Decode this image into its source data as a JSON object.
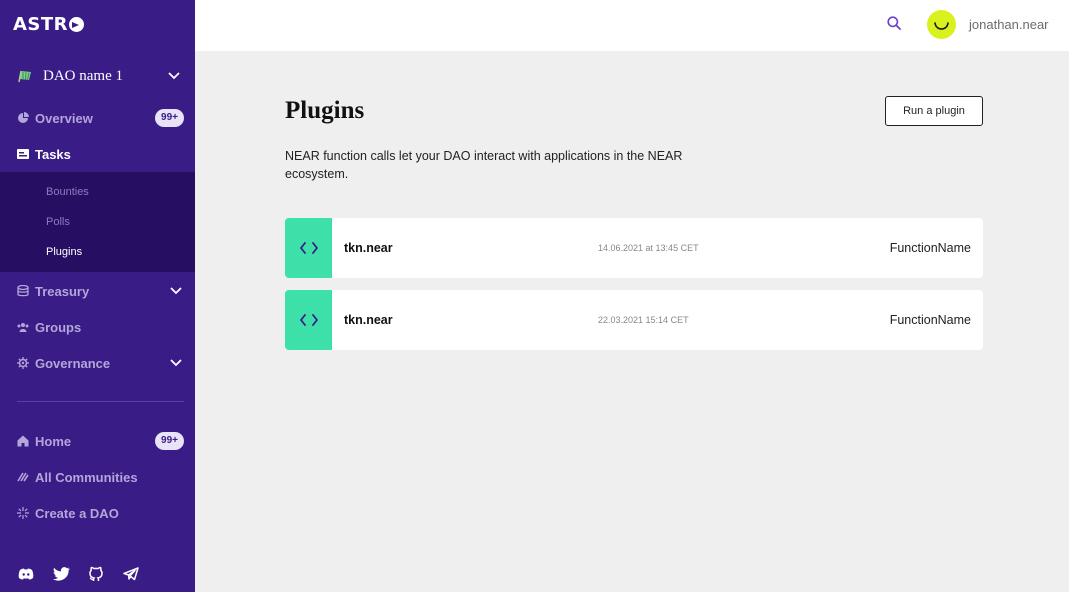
{
  "brand": {
    "logo_text": "ASTR"
  },
  "sidebar": {
    "dao_name": "DAO name 1",
    "nav": {
      "overview": {
        "label": "Overview",
        "badge": "99+"
      },
      "tasks": {
        "label": "Tasks"
      },
      "treasury": {
        "label": "Treasury"
      },
      "groups": {
        "label": "Groups"
      },
      "governance": {
        "label": "Governance"
      }
    },
    "subnav": {
      "bounties": "Bounties",
      "polls": "Polls",
      "plugins": "Plugins"
    },
    "secondary": {
      "home": {
        "label": "Home",
        "badge": "99+"
      },
      "communities": {
        "label": "All Communities"
      },
      "create": {
        "label": "Create a DAO"
      }
    },
    "socials": [
      "discord-icon",
      "twitter-icon",
      "github-icon",
      "telegram-icon"
    ]
  },
  "header": {
    "username": "jonathan.near"
  },
  "main": {
    "title": "Plugins",
    "run_button": "Run a plugin",
    "description": "NEAR function calls let your DAO interact with applications in the NEAR ecosystem.",
    "plugins": [
      {
        "name": "tkn.near",
        "date": "14.06.2021 at 13:45 CET",
        "function": "FunctionName"
      },
      {
        "name": "tkn.near",
        "date": "22.03.2021 15:14 CET",
        "function": "FunctionName"
      }
    ]
  },
  "colors": {
    "sidebar_bg": "#3a1c87",
    "subnav_bg": "#260f63",
    "accent_green": "#3de0a8",
    "avatar_yellow": "#d9f21d",
    "search_purple": "#6b3fd4"
  }
}
